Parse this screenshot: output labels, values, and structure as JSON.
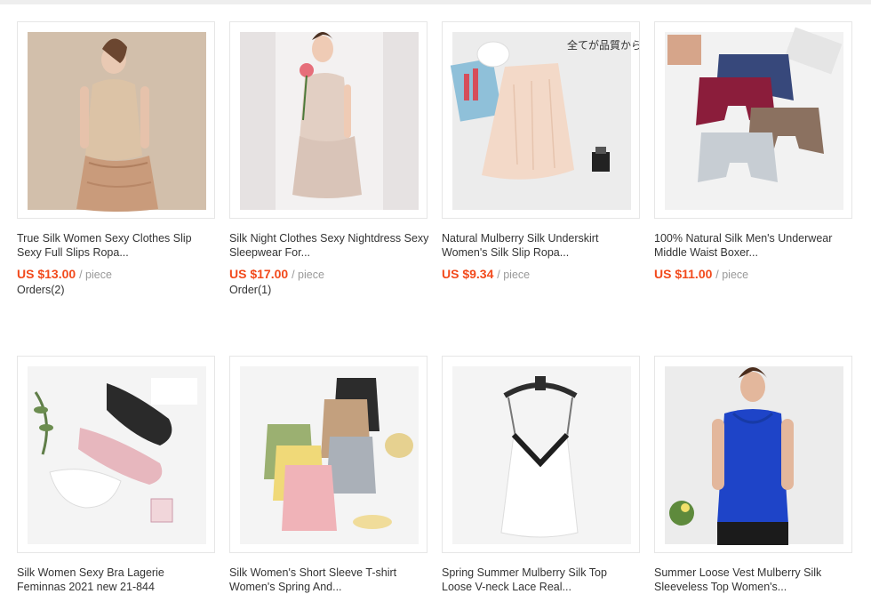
{
  "products": [
    {
      "image_alt": "Beige silk full slip with lace hem",
      "title": "True Silk Women Sexy Clothes Slip\nSexy Full Slips Ropa...",
      "price": "US $13.00",
      "unit": "/ piece",
      "orders": "Orders(2)"
    },
    {
      "image_alt": "Silk night dress with rose",
      "title": "Silk Night Clothes Sexy Nightdress Sexy\nSleepwear For...",
      "price": "US $17.00",
      "unit": "/ piece",
      "orders": "Order(1)"
    },
    {
      "image_alt": "Silk underskirt flat lay",
      "image_text": "全てが品質から",
      "title": "Natural Mulberry Silk Underskirt\nWomen's Silk Slip Ropa...",
      "price": "US $9.34",
      "unit": "/ piece",
      "orders": ""
    },
    {
      "image_alt": "Men's silk boxer briefs in four colors",
      "title": "100% Natural Silk Men's Underwear\nMiddle Waist Boxer...",
      "price": "US $11.00",
      "unit": "/ piece",
      "orders": ""
    },
    {
      "image_alt": "Silk lace bras flat lay",
      "title": "Silk Women Sexy Bra Lagerie\nFeminnas 2021 new 21-844",
      "price": "",
      "unit": "",
      "orders": ""
    },
    {
      "image_alt": "Folded silk t-shirts in several colors",
      "title": "Silk Women's Short Sleeve T-shirt\nWomen's Spring And...",
      "price": "",
      "unit": "",
      "orders": ""
    },
    {
      "image_alt": "White silk camisole with black lace on hanger",
      "title": "Spring Summer Mulberry Silk Top\nLoose V-neck Lace Real...",
      "price": "",
      "unit": "",
      "orders": ""
    },
    {
      "image_alt": "Blue silk vest top",
      "title": "Summer Loose Vest Mulberry Silk\nSleeveless Top Women's...",
      "price": "",
      "unit": "",
      "orders": ""
    }
  ],
  "colors": {
    "price": "#f24a1c",
    "unit": "#999999",
    "text": "#333333",
    "border": "#e6e6e6"
  }
}
